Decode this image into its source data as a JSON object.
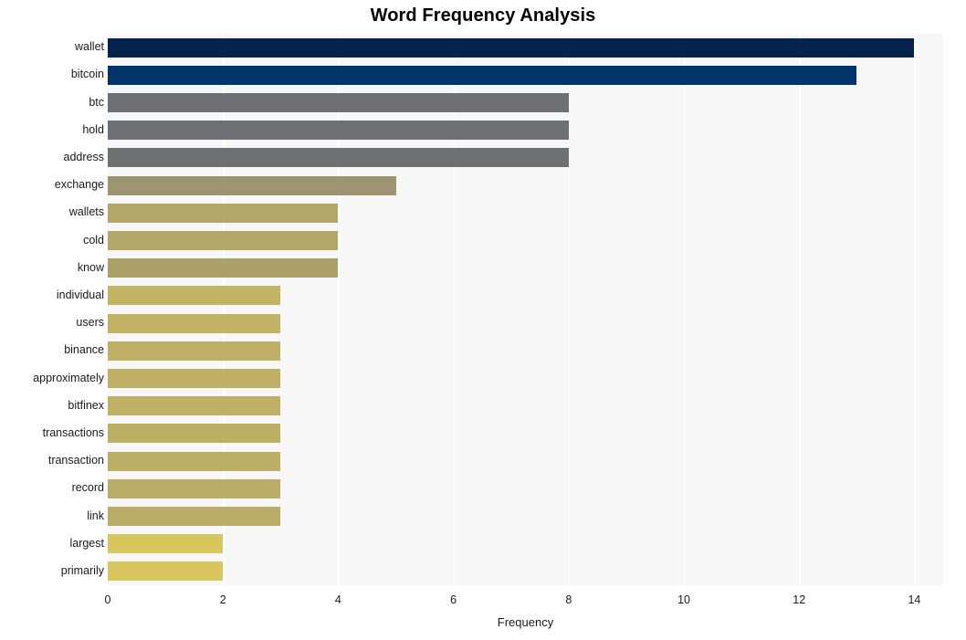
{
  "chart_data": {
    "type": "bar",
    "orientation": "horizontal",
    "title": "Word Frequency Analysis",
    "xlabel": "Frequency",
    "ylabel": "",
    "xlim": [
      0,
      14.5
    ],
    "xticks": [
      0,
      2,
      4,
      6,
      8,
      10,
      12,
      14
    ],
    "xtick_labels": [
      "0",
      "2",
      "4",
      "6",
      "8",
      "10",
      "12",
      "14"
    ],
    "grid": "vertical-white",
    "legend": "none",
    "categories": [
      "wallet",
      "bitcoin",
      "btc",
      "hold",
      "address",
      "exchange",
      "wallets",
      "cold",
      "know",
      "individual",
      "users",
      "binance",
      "approximately",
      "bitfinex",
      "transactions",
      "transaction",
      "record",
      "link",
      "largest",
      "primarily"
    ],
    "values": [
      14,
      13,
      8,
      8,
      8,
      5,
      4,
      4,
      4,
      3,
      3,
      3,
      3,
      3,
      3,
      3,
      3,
      3,
      2,
      2
    ],
    "bar_colors": [
      "#04234a",
      "#00356b",
      "#6e7073",
      "#6e7073",
      "#6e7073",
      "#9d9572",
      "#b2a668",
      "#b2a668",
      "#aca169",
      "#c3b464",
      "#c1b265",
      "#bfb066",
      "#bfb066",
      "#bfb066",
      "#bdae66",
      "#bdae66",
      "#bbac67",
      "#bbac67",
      "#d9c65e",
      "#d9c65e"
    ]
  },
  "style": {
    "figure_background": "#ffffff",
    "plot_background": "#f7f7f7",
    "gridline_color": "#ffffff",
    "text_color": "#1a1a1a",
    "title_color": "#000000"
  }
}
